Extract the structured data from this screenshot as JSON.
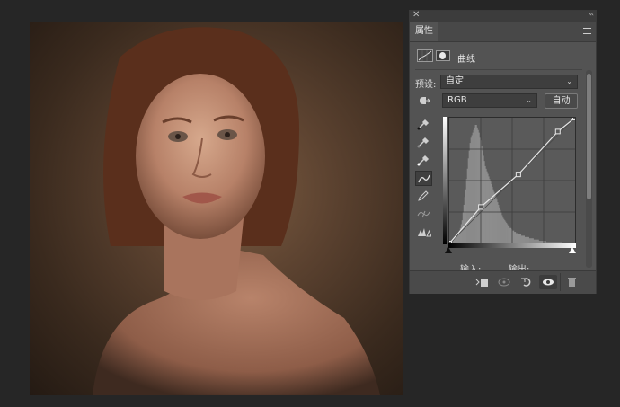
{
  "panel": {
    "close_glyph": "✕",
    "collapse_glyph": "‹‹",
    "tab_label": "属性",
    "menu_icon": "panel-menu-icon",
    "adjustment_label": "曲线",
    "preset": {
      "label": "预设:",
      "value": "自定"
    },
    "channel": {
      "value": "RGB"
    },
    "auto_button": "自动",
    "input_label": "输入:",
    "output_label": "输出:",
    "tools": [
      "target-adjust-icon",
      "black-eyedropper-icon",
      "gray-eyedropper-icon",
      "white-eyedropper-icon",
      "curve-points-icon",
      "pencil-icon",
      "smooth-icon",
      "clipping-warning-icon"
    ],
    "bottom_icons": [
      "clip-to-layer-icon",
      "view-previous-icon",
      "reset-icon",
      "visibility-eye-icon",
      "trash-icon"
    ]
  },
  "curve": {
    "points": [
      [
        0,
        0
      ],
      [
        64,
        74
      ],
      [
        140,
        140
      ],
      [
        220,
        227
      ],
      [
        255,
        255
      ]
    ],
    "histogram": [
      0,
      0,
      1,
      1,
      2,
      3,
      4,
      5,
      5,
      6,
      8,
      10,
      12,
      15,
      18,
      24,
      30,
      36,
      42,
      50,
      58,
      66,
      72,
      78,
      82,
      84,
      86,
      88,
      90,
      92,
      92,
      90,
      88,
      86,
      82,
      80,
      76,
      72,
      68,
      64,
      60,
      58,
      56,
      54,
      52,
      50,
      48,
      46,
      44,
      42,
      40,
      38,
      36,
      34,
      32,
      30,
      28,
      26,
      24,
      22,
      20,
      19,
      18,
      17,
      16,
      15,
      14,
      13,
      12,
      12,
      11,
      10,
      10,
      9,
      9,
      8,
      8,
      8,
      7,
      7,
      7,
      6,
      6,
      6,
      6,
      5,
      5,
      5,
      5,
      5,
      4,
      4,
      4,
      4,
      4,
      3,
      3,
      3,
      3,
      3,
      3,
      2,
      2,
      2,
      2,
      2,
      2,
      2,
      2,
      1,
      1,
      1,
      1,
      1,
      1,
      1,
      1,
      1,
      1,
      1,
      1,
      1,
      1,
      1,
      1,
      1,
      1,
      0,
      0,
      0,
      0,
      0,
      0,
      0,
      0,
      0,
      0,
      0,
      0,
      0,
      0,
      0
    ]
  }
}
